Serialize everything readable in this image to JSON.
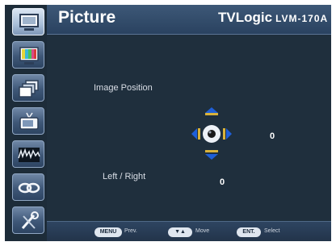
{
  "header": {
    "title": "Picture",
    "brand": "TVLogic",
    "model": "LVM-170A"
  },
  "sidebar": {
    "items": [
      {
        "name": "picture",
        "icon": "monitor-icon",
        "active": true
      },
      {
        "name": "color",
        "icon": "color-bars-icon",
        "active": false
      },
      {
        "name": "layers",
        "icon": "layers-icon",
        "active": false
      },
      {
        "name": "input",
        "icon": "tv-icon",
        "active": false
      },
      {
        "name": "waveform",
        "icon": "waveform-icon",
        "active": false
      },
      {
        "name": "link",
        "icon": "link-icon",
        "active": false
      },
      {
        "name": "tools",
        "icon": "tools-icon",
        "active": false
      }
    ]
  },
  "main": {
    "image_position_label": "Image Position",
    "position_value": "0",
    "left_right_label": "Left / Right",
    "left_right_value": "0"
  },
  "footer": {
    "menu_key": "MENU",
    "menu_action": "Prev.",
    "move_key": "▼▲",
    "move_action": "Move",
    "ent_key": "ENT.",
    "ent_action": "Select"
  },
  "colors": {
    "accent_blue": "#1f5fd8",
    "accent_gold": "#d9b23a",
    "panel": "#1f2f3d"
  }
}
